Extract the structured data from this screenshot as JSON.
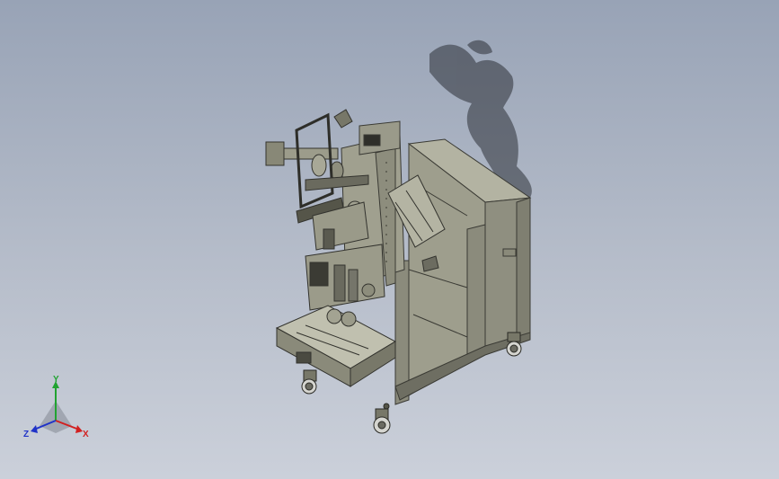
{
  "triad": {
    "x_label": "X",
    "y_label": "Y",
    "z_label": "Z"
  },
  "colors": {
    "background_top": "#98a3b6",
    "background_bottom": "#cbd0da",
    "body_metal": "#a9a998",
    "edge_line": "#3a3a34",
    "axis_x": "#d22020",
    "axis_y": "#21a331",
    "axis_z": "#2033c8"
  }
}
